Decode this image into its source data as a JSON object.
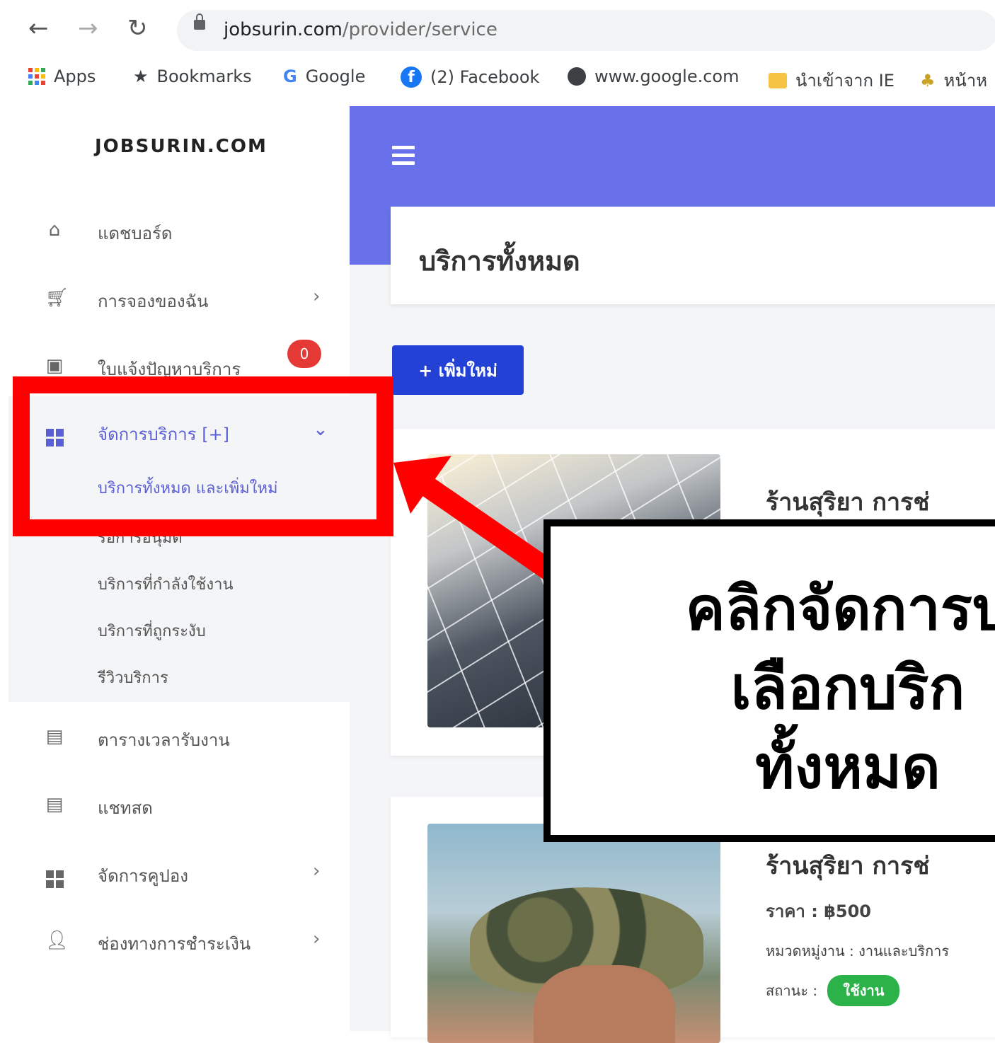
{
  "browser": {
    "url_host": "jobsurin.com",
    "url_path": "/provider/service",
    "bookmarks": [
      "Apps",
      "Bookmarks",
      "Google",
      "(2) Facebook",
      "www.google.com",
      "นำเข้าจาก IE",
      "หน้าห"
    ]
  },
  "sidebar": {
    "brand": "JOBSURIN.COM",
    "items": [
      {
        "label": "แดชบอร์ด",
        "icon": "home-icon"
      },
      {
        "label": "การจองของฉัน",
        "icon": "cart-icon"
      },
      {
        "label": "ใบแจ้งปัญหาบริการ",
        "icon": "inbox-icon",
        "badge": "0"
      },
      {
        "label": "จัดการบริการ [+]",
        "icon": "grid-icon"
      },
      {
        "label": "ตารางเวลารับงาน",
        "icon": "calendar-icon"
      },
      {
        "label": "แชทสด",
        "icon": "chat-icon"
      },
      {
        "label": "จัดการคูปอง",
        "icon": "grid-icon"
      },
      {
        "label": "ช่องทางการชำระเงิน",
        "icon": "user-icon"
      }
    ],
    "submenu": [
      "บริการทั้งหมด และเพิ่มใหม่",
      "รอการอนุมัติ",
      "บริการที่กำลังใช้งาน",
      "บริการที่ถูกระงับ",
      "รีวิวบริการ"
    ]
  },
  "main": {
    "page_title": "บริการทั้งหมด",
    "add_button": "+ เพิ่มใหม่",
    "services": [
      {
        "title": "ร้านสุริยา การช่"
      },
      {
        "title": "ร้านสุริยา การช่",
        "price": "ราคา : ฿500",
        "category": "หมวดหมู่งาน : งานและบริการ",
        "status_label": "สถานะ :",
        "status": "ใช้งาน"
      }
    ]
  },
  "annotation": {
    "lines": [
      "คลิกจัดการบ",
      "เลือกบริก",
      "ทั้งหมด"
    ]
  },
  "colors": {
    "accent": "#6871e9",
    "button": "#2341d4",
    "highlight": "#ff0000",
    "status_ok": "#2bb34a"
  }
}
